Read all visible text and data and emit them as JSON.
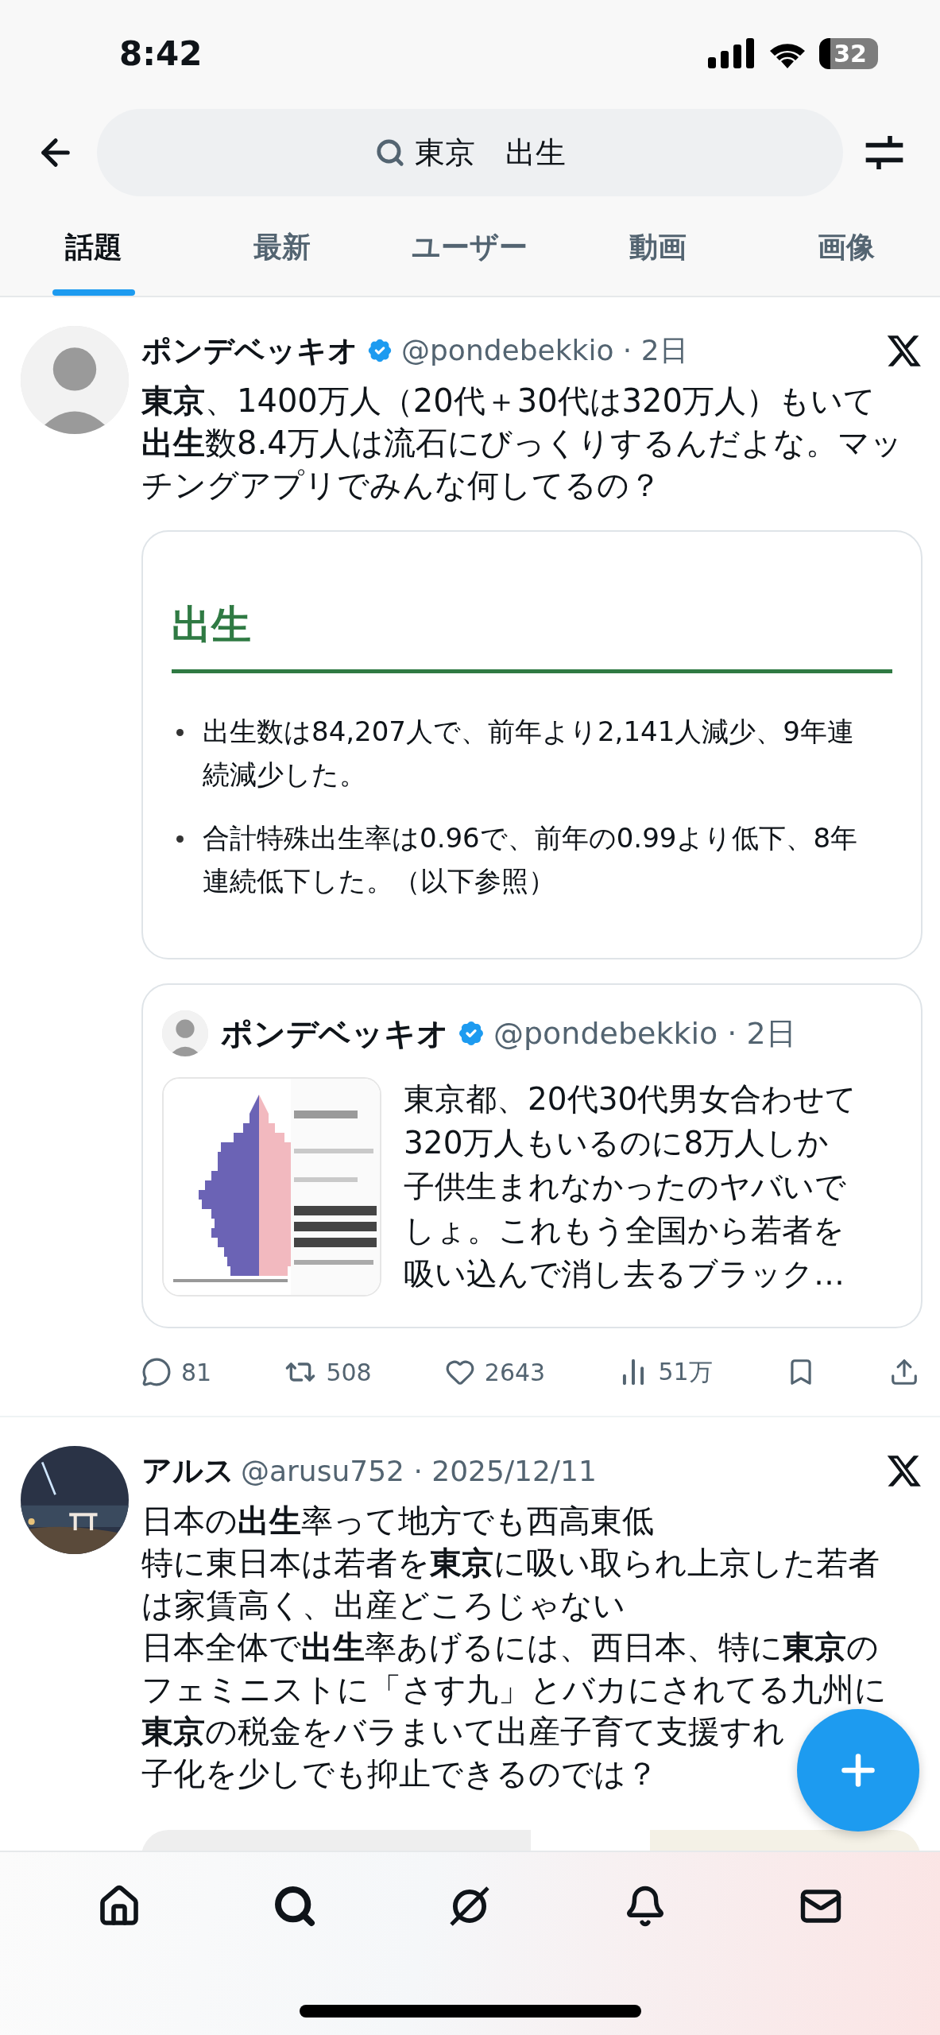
{
  "status_bar": {
    "time": "8:42",
    "battery": "32"
  },
  "search": {
    "query": "東京　出生"
  },
  "tabs": [
    {
      "label": "話題",
      "selected": true
    },
    {
      "label": "最新",
      "selected": false
    },
    {
      "label": "ユーザー",
      "selected": false
    },
    {
      "label": "動画",
      "selected": false
    },
    {
      "label": "画像",
      "selected": false
    }
  ],
  "tweets": [
    {
      "avatar": {
        "kind": "figure"
      },
      "name": "ポンデベッキオ",
      "verified": true,
      "meta": "@pondebekkio · 2日",
      "lines": [
        "**東京**、1400万人（20代＋30代は320万人）もいて",
        "**出生**数8.4万人は流石にびっくりするんだよな。マッ",
        "チングアプリでみんな何してるの？"
      ],
      "card": {
        "heading": "出生",
        "bullets": [
          [
            "出生数は84,207人で、前年より2,141人減少、9年連",
            "続減少した。"
          ],
          [
            "合計特殊出生率は0.96で、前年の0.99より低下、8年",
            "連続低下した。（以下参照）"
          ]
        ]
      },
      "quote": {
        "name": "ポンデベッキオ",
        "verified": true,
        "meta": "@pondebekkio · 2日",
        "lines": [
          "東京都、20代30代男女合わせて",
          "320万人もいるのに8万人しか",
          "子供生まれなかったのヤバいで",
          "しょ。これもう全国から若者を",
          "吸い込んで消し去るブラック…"
        ]
      },
      "stats": {
        "replies": "81",
        "reposts": "508",
        "likes": "2643",
        "views": "51万"
      }
    },
    {
      "name": "アルス",
      "verified": false,
      "meta": "@arusu752 · 2025/12/11",
      "lines": [
        "日本の**出生**率って地方でも西高東低",
        "特に東日本は若者を**東京**に吸い取られ上京した若者",
        "は家賃高く、出産どころじゃない",
        "日本全体で**出生**率あげるには、西日本、特に**東京**の",
        "フェミニストに「さす九」とバカにされてる九州に",
        "**東京**の税金をバラまいて出産子育て支援すれ",
        "子化を少しでも抑止できるのでは？"
      ]
    }
  ]
}
